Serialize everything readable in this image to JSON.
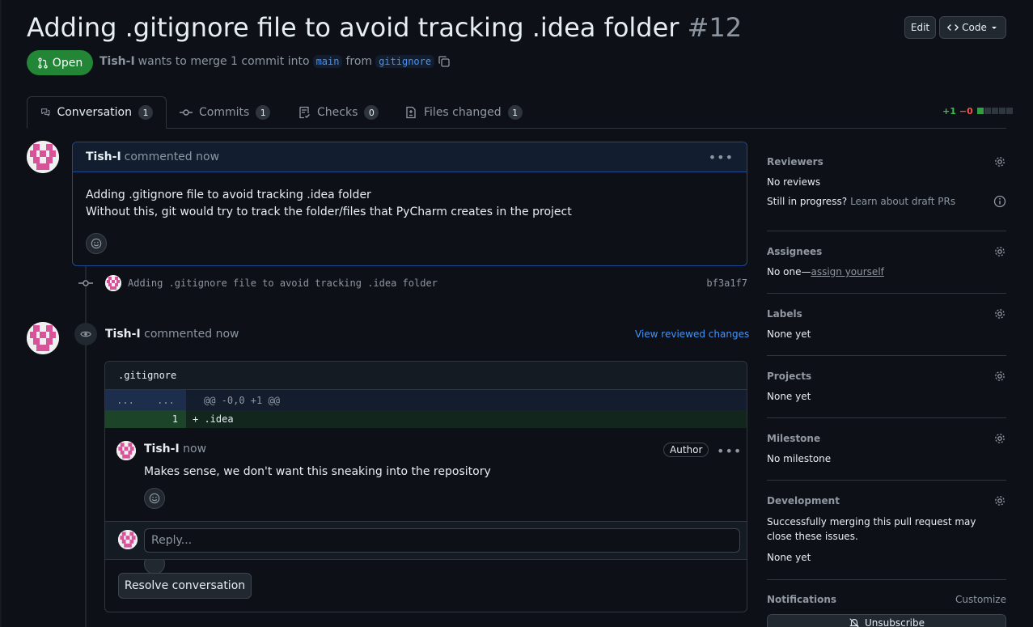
{
  "pr": {
    "title": "Adding .gitignore file to avoid tracking .idea folder",
    "number": "#12",
    "state": "Open",
    "author": "Tish-I",
    "merge_text": "wants to merge 1 commit into",
    "base_branch": "main",
    "from_text": "from",
    "head_branch": "gitignore"
  },
  "header_buttons": {
    "edit": "Edit",
    "code": "Code"
  },
  "tabs": [
    {
      "label": "Conversation",
      "count": "1"
    },
    {
      "label": "Commits",
      "count": "1"
    },
    {
      "label": "Checks",
      "count": "0"
    },
    {
      "label": "Files changed",
      "count": "1"
    }
  ],
  "diffstat": {
    "additions": "+1",
    "deletions": "−0"
  },
  "first_comment": {
    "author": "Tish-I",
    "action": "commented now",
    "line1": "Adding .gitignore file to avoid tracking .idea folder",
    "line2": "Without this, git would try to track the folder/files that PyCharm creates in the project"
  },
  "commit": {
    "message": "Adding .gitignore file to avoid tracking .idea folder",
    "sha": "bf3a1f7"
  },
  "review": {
    "author": "Tish-I",
    "action": "commented now",
    "view_changes": "View reviewed changes",
    "file": ".gitignore",
    "hunk_gutter_left": "...",
    "hunk_gutter_right": "...",
    "hunk_header": "@@ -0,0 +1 @@",
    "line_number": "1",
    "line_content": "+ .idea",
    "comment_author": "Tish-I",
    "comment_time": "now",
    "badge": "Author",
    "comment_text": "Makes sense, we don't want this sneaking into the repository",
    "reply_placeholder": "Reply...",
    "resolve": "Resolve conversation"
  },
  "sidebar": {
    "reviewers": {
      "title": "Reviewers",
      "value": "No reviews",
      "draft_text": "Still in progress?",
      "draft_link": "Learn about draft PRs"
    },
    "assignees": {
      "title": "Assignees",
      "value": "No one—",
      "link": "assign yourself"
    },
    "labels": {
      "title": "Labels",
      "value": "None yet"
    },
    "projects": {
      "title": "Projects",
      "value": "None yet"
    },
    "milestone": {
      "title": "Milestone",
      "value": "No milestone"
    },
    "development": {
      "title": "Development",
      "description": "Successfully merging this pull request may close these issues.",
      "value": "None yet"
    },
    "notifications": {
      "title": "Notifications",
      "customize": "Customize",
      "unsubscribe": "Unsubscribe"
    }
  },
  "colors": {
    "open_green": "#238636",
    "link_blue": "#4493f8",
    "addition": "#3fb950",
    "deletion": "#f85149"
  }
}
